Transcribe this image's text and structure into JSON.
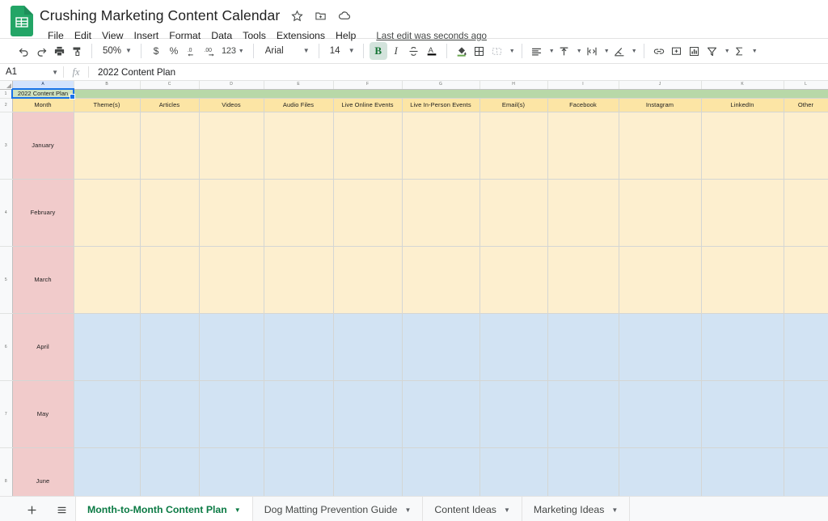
{
  "app": {
    "logo_icon": "sheets-logo-icon"
  },
  "title": {
    "document_name": "Crushing Marketing Content Calendar",
    "star_icon": "star-icon",
    "move_icon": "move-to-folder-icon",
    "cloud_icon": "cloud-saved-icon",
    "last_edit": "Last edit was seconds ago"
  },
  "menu": {
    "items": [
      {
        "label": "File"
      },
      {
        "label": "Edit"
      },
      {
        "label": "View"
      },
      {
        "label": "Insert"
      },
      {
        "label": "Format"
      },
      {
        "label": "Data"
      },
      {
        "label": "Tools"
      },
      {
        "label": "Extensions"
      },
      {
        "label": "Help"
      }
    ]
  },
  "toolbar": {
    "undo_icon": "undo-icon",
    "redo_icon": "redo-icon",
    "print_icon": "print-icon",
    "paint_format_icon": "paint-format-icon",
    "zoom_value": "50%",
    "currency_icon": "$",
    "percent_icon": "%",
    "decrease_decimal_icon": ".0",
    "increase_decimal_icon": ".00",
    "number_format_label": "123",
    "font_family": "Arial",
    "font_size": "14",
    "bold_label": "B",
    "italic_label": "I",
    "strikethrough_icon": "strikethrough-icon",
    "text_color_icon": "text-color-icon",
    "fill_color_icon": "fill-color-icon",
    "borders_icon": "borders-icon",
    "merge_cells_icon": "merge-cells-icon",
    "horizontal_align_icon": "horizontal-align-icon",
    "vertical_align_icon": "vertical-align-icon",
    "text_wrapping_icon": "text-wrapping-icon",
    "text_rotation_icon": "text-rotation-icon",
    "insert_link_icon": "insert-link-icon",
    "insert_comment_icon": "insert-comment-icon",
    "insert_chart_icon": "insert-chart-icon",
    "filter_icon": "filter-icon",
    "functions_icon": "functions-sigma-icon"
  },
  "formula_bar": {
    "name_box": "A1",
    "fx_label": "fx",
    "formula_value": "2022 Content Plan"
  },
  "sheet": {
    "column_letters": [
      "A",
      "B",
      "C",
      "D",
      "E",
      "F",
      "G",
      "H",
      "I",
      "J",
      "K",
      "L"
    ],
    "banner_title": "2022 Content Plan",
    "headers": [
      "Month",
      "Theme(s)",
      "Articles",
      "Videos",
      "Audio Files",
      "Live Online Events",
      "Live In-Person Events",
      "Email(s)",
      "Facebook",
      "Instagram",
      "LinkedIn",
      "Other"
    ],
    "rows": [
      {
        "row_number": "3",
        "month": "January",
        "band": "yellow",
        "cells": [
          "",
          "",
          "",
          "",
          "",
          "",
          "",
          "",
          "",
          "",
          ""
        ]
      },
      {
        "row_number": "4",
        "month": "February",
        "band": "yellow",
        "cells": [
          "",
          "",
          "",
          "",
          "",
          "",
          "",
          "",
          "",
          "",
          ""
        ]
      },
      {
        "row_number": "5",
        "month": "March",
        "band": "yellow",
        "cells": [
          "",
          "",
          "",
          "",
          "",
          "",
          "",
          "",
          "",
          "",
          ""
        ]
      },
      {
        "row_number": "6",
        "month": "April",
        "band": "blue",
        "cells": [
          "",
          "",
          "",
          "",
          "",
          "",
          "",
          "",
          "",
          "",
          ""
        ]
      },
      {
        "row_number": "7",
        "month": "May",
        "band": "blue",
        "cells": [
          "",
          "",
          "",
          "",
          "",
          "",
          "",
          "",
          "",
          "",
          ""
        ]
      },
      {
        "row_number": "8",
        "month": "June",
        "band": "blue",
        "cells": [
          "",
          "",
          "",
          "",
          "",
          "",
          "",
          "",
          "",
          "",
          ""
        ]
      }
    ]
  },
  "sheet_tabs": {
    "add_sheet_icon": "add-sheet-icon",
    "all_sheets_icon": "all-sheets-list-icon",
    "tabs": [
      {
        "label": "Month-to-Month Content Plan",
        "active": true
      },
      {
        "label": "Dog Matting Prevention Guide",
        "active": false
      },
      {
        "label": "Content Ideas",
        "active": false
      },
      {
        "label": "Marketing Ideas",
        "active": false
      }
    ]
  },
  "colors": {
    "banner_green": "#b8d8a8",
    "header_yellow": "#fce5a5",
    "month_pink": "#f1cbcb",
    "body_yellow": "#fdefcf",
    "body_blue": "#d2e3f3",
    "sheets_green": "#23a566",
    "active_tab_green": "#0b7a44",
    "selection_blue": "#1a73e8"
  }
}
